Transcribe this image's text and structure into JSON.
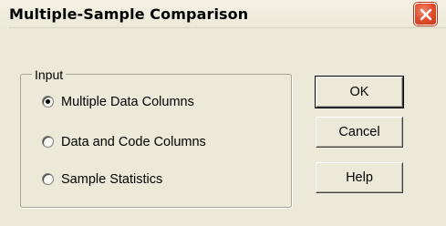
{
  "window": {
    "title": "Multiple-Sample Comparison",
    "close_icon": "close-icon"
  },
  "group": {
    "label": "Input",
    "options": [
      {
        "label": "Multiple Data Columns",
        "selected": true
      },
      {
        "label": "Data and Code Columns",
        "selected": false
      },
      {
        "label": "Sample Statistics",
        "selected": false
      }
    ]
  },
  "buttons": {
    "ok": "OK",
    "cancel": "Cancel",
    "help": "Help"
  },
  "colors": {
    "dialog_bg": "#ece9d8",
    "close_button": "#e04a2a"
  }
}
